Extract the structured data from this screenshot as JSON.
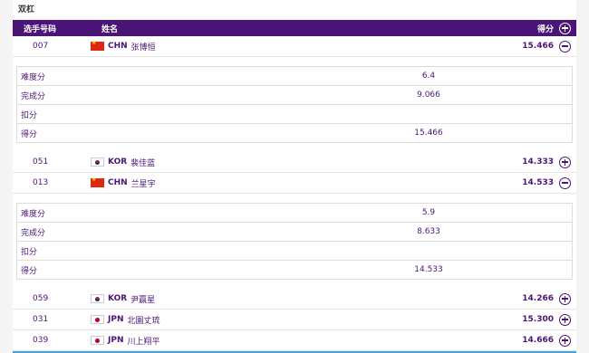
{
  "section_title": "双杠",
  "header": {
    "num": "选手号码",
    "name": "姓名",
    "score": "得分"
  },
  "detail_labels": {
    "difficulty": "难度分",
    "execution": "完成分",
    "penalty": "扣分",
    "total": "得分"
  },
  "athletes": [
    {
      "num": "007",
      "noc": "CHN",
      "name": "张博恒",
      "score": "15.466",
      "expanded": true,
      "detail": {
        "difficulty": "6.4",
        "execution": "9.066",
        "penalty": "",
        "total": "15.466"
      }
    },
    {
      "num": "051",
      "noc": "KOR",
      "name": "裴佳蓝",
      "score": "14.333",
      "expanded": false
    },
    {
      "num": "013",
      "noc": "CHN",
      "name": "兰星宇",
      "score": "14.533",
      "expanded": true,
      "detail": {
        "difficulty": "5.9",
        "execution": "8.633",
        "penalty": "",
        "total": "14.533"
      }
    },
    {
      "num": "059",
      "noc": "KOR",
      "name": "尹赢星",
      "score": "14.266",
      "expanded": false
    },
    {
      "num": "031",
      "noc": "JPN",
      "name": "北園丈琉",
      "score": "15.300",
      "expanded": false
    },
    {
      "num": "039",
      "noc": "JPN",
      "name": "川上翔平",
      "score": "14.666",
      "expanded": false
    }
  ],
  "colors": {
    "header_bg": "#4b1578",
    "accent": "#4b1578",
    "bottom_bar": "#4ba3d9"
  }
}
